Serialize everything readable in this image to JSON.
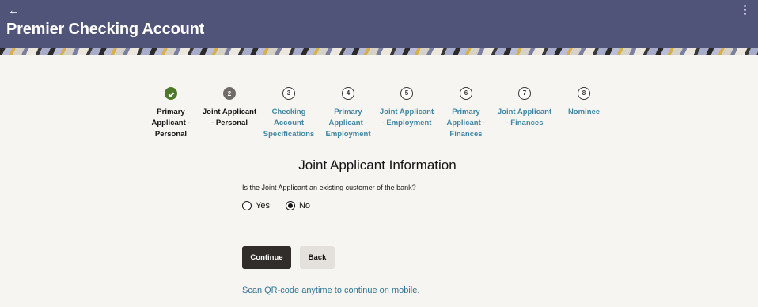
{
  "header": {
    "back_icon": "←",
    "title": "Premier Checking Account"
  },
  "stepper": {
    "steps": [
      {
        "number": "1",
        "label": "Primary\nApplicant -\nPersonal",
        "state": "completed"
      },
      {
        "number": "2",
        "label": "Joint Applicant\n- Personal",
        "state": "current"
      },
      {
        "number": "3",
        "label": "Checking\nAccount\nSpecifications",
        "state": "pending"
      },
      {
        "number": "4",
        "label": "Primary\nApplicant -\nEmployment",
        "state": "pending"
      },
      {
        "number": "5",
        "label": "Joint Applicant\n- Employment",
        "state": "pending"
      },
      {
        "number": "6",
        "label": "Primary\nApplicant -\nFinances",
        "state": "pending"
      },
      {
        "number": "7",
        "label": "Joint Applicant\n- Finances",
        "state": "pending"
      },
      {
        "number": "8",
        "label": "Nominee",
        "state": "pending"
      }
    ]
  },
  "form": {
    "title": "Joint Applicant Information",
    "question": "Is the Joint Applicant an existing customer of the bank?",
    "options": [
      {
        "label": "Yes",
        "selected": false
      },
      {
        "label": "No",
        "selected": true
      }
    ],
    "continue_label": "Continue",
    "back_label": "Back",
    "qr_text": "Scan QR-code anytime to continue on mobile."
  },
  "colors": {
    "header_bg": "#4f5478",
    "completed_step": "#4c7a2a",
    "link": "#3f86a6",
    "primary_button": "#312d2a"
  }
}
